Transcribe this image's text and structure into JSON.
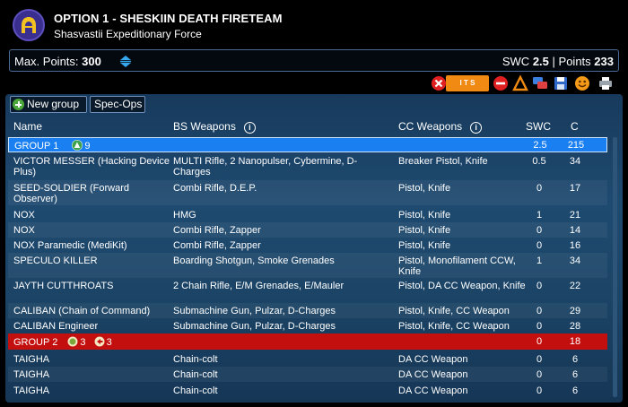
{
  "header": {
    "title": "OPTION 1 - SHESKIIN DEATH FIRETEAM",
    "subtitle": "Shasvastii Expeditionary Force"
  },
  "points": {
    "max_label": "Max. Points:",
    "max_value": "300",
    "swc_label": "SWC",
    "swc_value": "2.5",
    "separator": "|",
    "points_label": "Points",
    "points_value": "233"
  },
  "toolbar": {
    "new_group_label": "New group",
    "spec_ops_label": "Spec-Ops",
    "its_label": "I T S"
  },
  "columns": {
    "name": "Name",
    "bs_weapons": "BS Weapons",
    "cc_weapons": "CC Weapons",
    "swc": "SWC",
    "c": "C",
    "info_glyph": "i"
  },
  "groups": [
    {
      "label": "GROUP 1",
      "order_count": "9",
      "swc": "2.5",
      "c": "215",
      "color": "#1a7ff0"
    },
    {
      "label": "GROUP 2",
      "order_count_a": "3",
      "order_count_b": "3",
      "swc": "0",
      "c": "18",
      "color": "#c40f0f"
    }
  ],
  "units": [
    {
      "name": "VICTOR MESSER (Hacking Device Plus)",
      "bs": "MULTI Rifle, 2 Nanopulser, Cybermine, D-Charges",
      "cc": "Breaker Pistol, Knife",
      "swc": "0.5",
      "c": "34"
    },
    {
      "name": "SEED-SOLDIER (Forward Observer)",
      "bs": "Combi Rifle, D.E.P.",
      "cc": "Pistol, Knife",
      "swc": "0",
      "c": "17"
    },
    {
      "name": "NOX",
      "bs": "HMG",
      "cc": "Pistol, Knife",
      "swc": "1",
      "c": "21"
    },
    {
      "name": "NOX",
      "bs": "Combi Rifle, Zapper",
      "cc": "Pistol, Knife",
      "swc": "0",
      "c": "14"
    },
    {
      "name": "NOX Paramedic (MediKit)",
      "bs": "Combi Rifle, Zapper",
      "cc": "Pistol, Knife",
      "swc": "0",
      "c": "16"
    },
    {
      "name": "SPECULO KILLER",
      "bs": "Boarding Shotgun, Smoke Grenades",
      "cc": "Pistol, Monofilament CCW, Knife",
      "swc": "1",
      "c": "34"
    },
    {
      "name": "JAYTH CUTTHROATS",
      "bs": "2 Chain Rifle, E/M Grenades, E/Mauler",
      "cc": "Pistol, DA CC Weapon, Knife",
      "swc": "0",
      "c": "22"
    },
    {
      "name": "CALIBAN (Chain of Command)",
      "bs": "Submachine Gun, Pulzar, D-Charges",
      "cc": "Pistol, Knife, CC Weapon",
      "swc": "0",
      "c": "29"
    },
    {
      "name": "CALIBAN Engineer",
      "bs": "Submachine Gun, Pulzar, D-Charges",
      "cc": "Pistol, Knife, CC Weapon",
      "swc": "0",
      "c": "28"
    },
    {
      "name": "TAIGHA",
      "bs": "Chain-colt",
      "cc": "DA CC Weapon",
      "swc": "0",
      "c": "6"
    },
    {
      "name": "TAIGHA",
      "bs": "Chain-colt",
      "cc": "DA CC Weapon",
      "swc": "0",
      "c": "6"
    },
    {
      "name": "TAIGHA",
      "bs": "Chain-colt",
      "cc": "DA CC Weapon",
      "swc": "0",
      "c": "6"
    }
  ],
  "icons": [
    "faction-logo-icon",
    "swap-arrows-icon",
    "close-icon",
    "its-badge-icon",
    "remove-icon",
    "alert-icon",
    "chat-icon",
    "save-icon",
    "emoji-icon",
    "print-icon",
    "info-icon",
    "plus-icon",
    "regular-order-icon",
    "irregular-order-icon",
    "impetuous-order-icon"
  ]
}
